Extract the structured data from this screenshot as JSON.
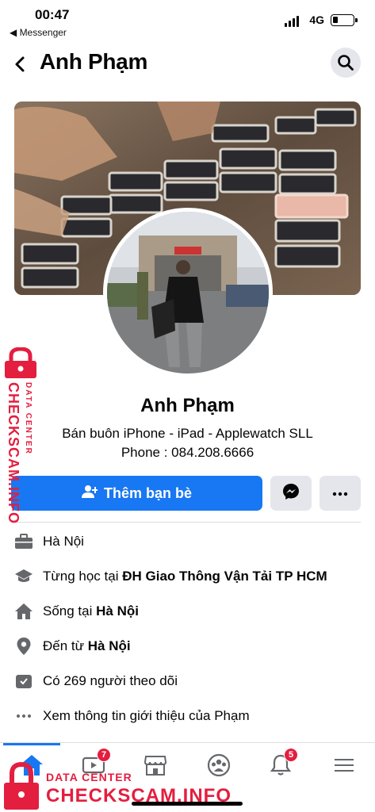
{
  "status_bar": {
    "time": "00:47",
    "back_app": "◀ Messenger",
    "network": "4G"
  },
  "header": {
    "title": "Anh Phạm",
    "back_icon": "chevron-left-icon",
    "search_icon": "search-icon"
  },
  "profile": {
    "name": "Anh Phạm",
    "bio_line1": "Bán buôn iPhone - iPad - Applewatch SLL",
    "bio_line2": "Phone : 084.208.6666"
  },
  "actions": {
    "add_friend_label": "Thêm bạn bè"
  },
  "info": [
    {
      "icon": "briefcase-icon",
      "pre": "Hà Nội",
      "bold": ""
    },
    {
      "icon": "graduation-cap-icon",
      "pre": "Từng học tại ",
      "bold": "ĐH Giao Thông Vận Tải TP HCM"
    },
    {
      "icon": "home-icon",
      "pre": "Sống tại ",
      "bold": "Hà Nội"
    },
    {
      "icon": "location-pin-icon",
      "pre": "Đến từ ",
      "bold": "Hà Nội"
    },
    {
      "icon": "followers-icon",
      "pre": "Có 269 người theo dõi",
      "bold": ""
    },
    {
      "icon": "ellipsis-icon",
      "pre": "Xem thông tin giới thiệu của Phạm",
      "bold": ""
    }
  ],
  "tabbar": {
    "items": [
      {
        "name": "home",
        "badge": ""
      },
      {
        "name": "watch",
        "badge": "7"
      },
      {
        "name": "marketplace",
        "badge": ""
      },
      {
        "name": "groups",
        "badge": ""
      },
      {
        "name": "notifications",
        "badge": "5"
      },
      {
        "name": "menu",
        "badge": ""
      }
    ]
  },
  "watermark": {
    "brand": "CHECKSCAM.INFO",
    "sub": "DATA CENTER"
  },
  "colors": {
    "accent": "#1877f2",
    "badge": "#e41e3f",
    "button_gray": "#e4e6eb",
    "watermark": "#e41e3f"
  }
}
